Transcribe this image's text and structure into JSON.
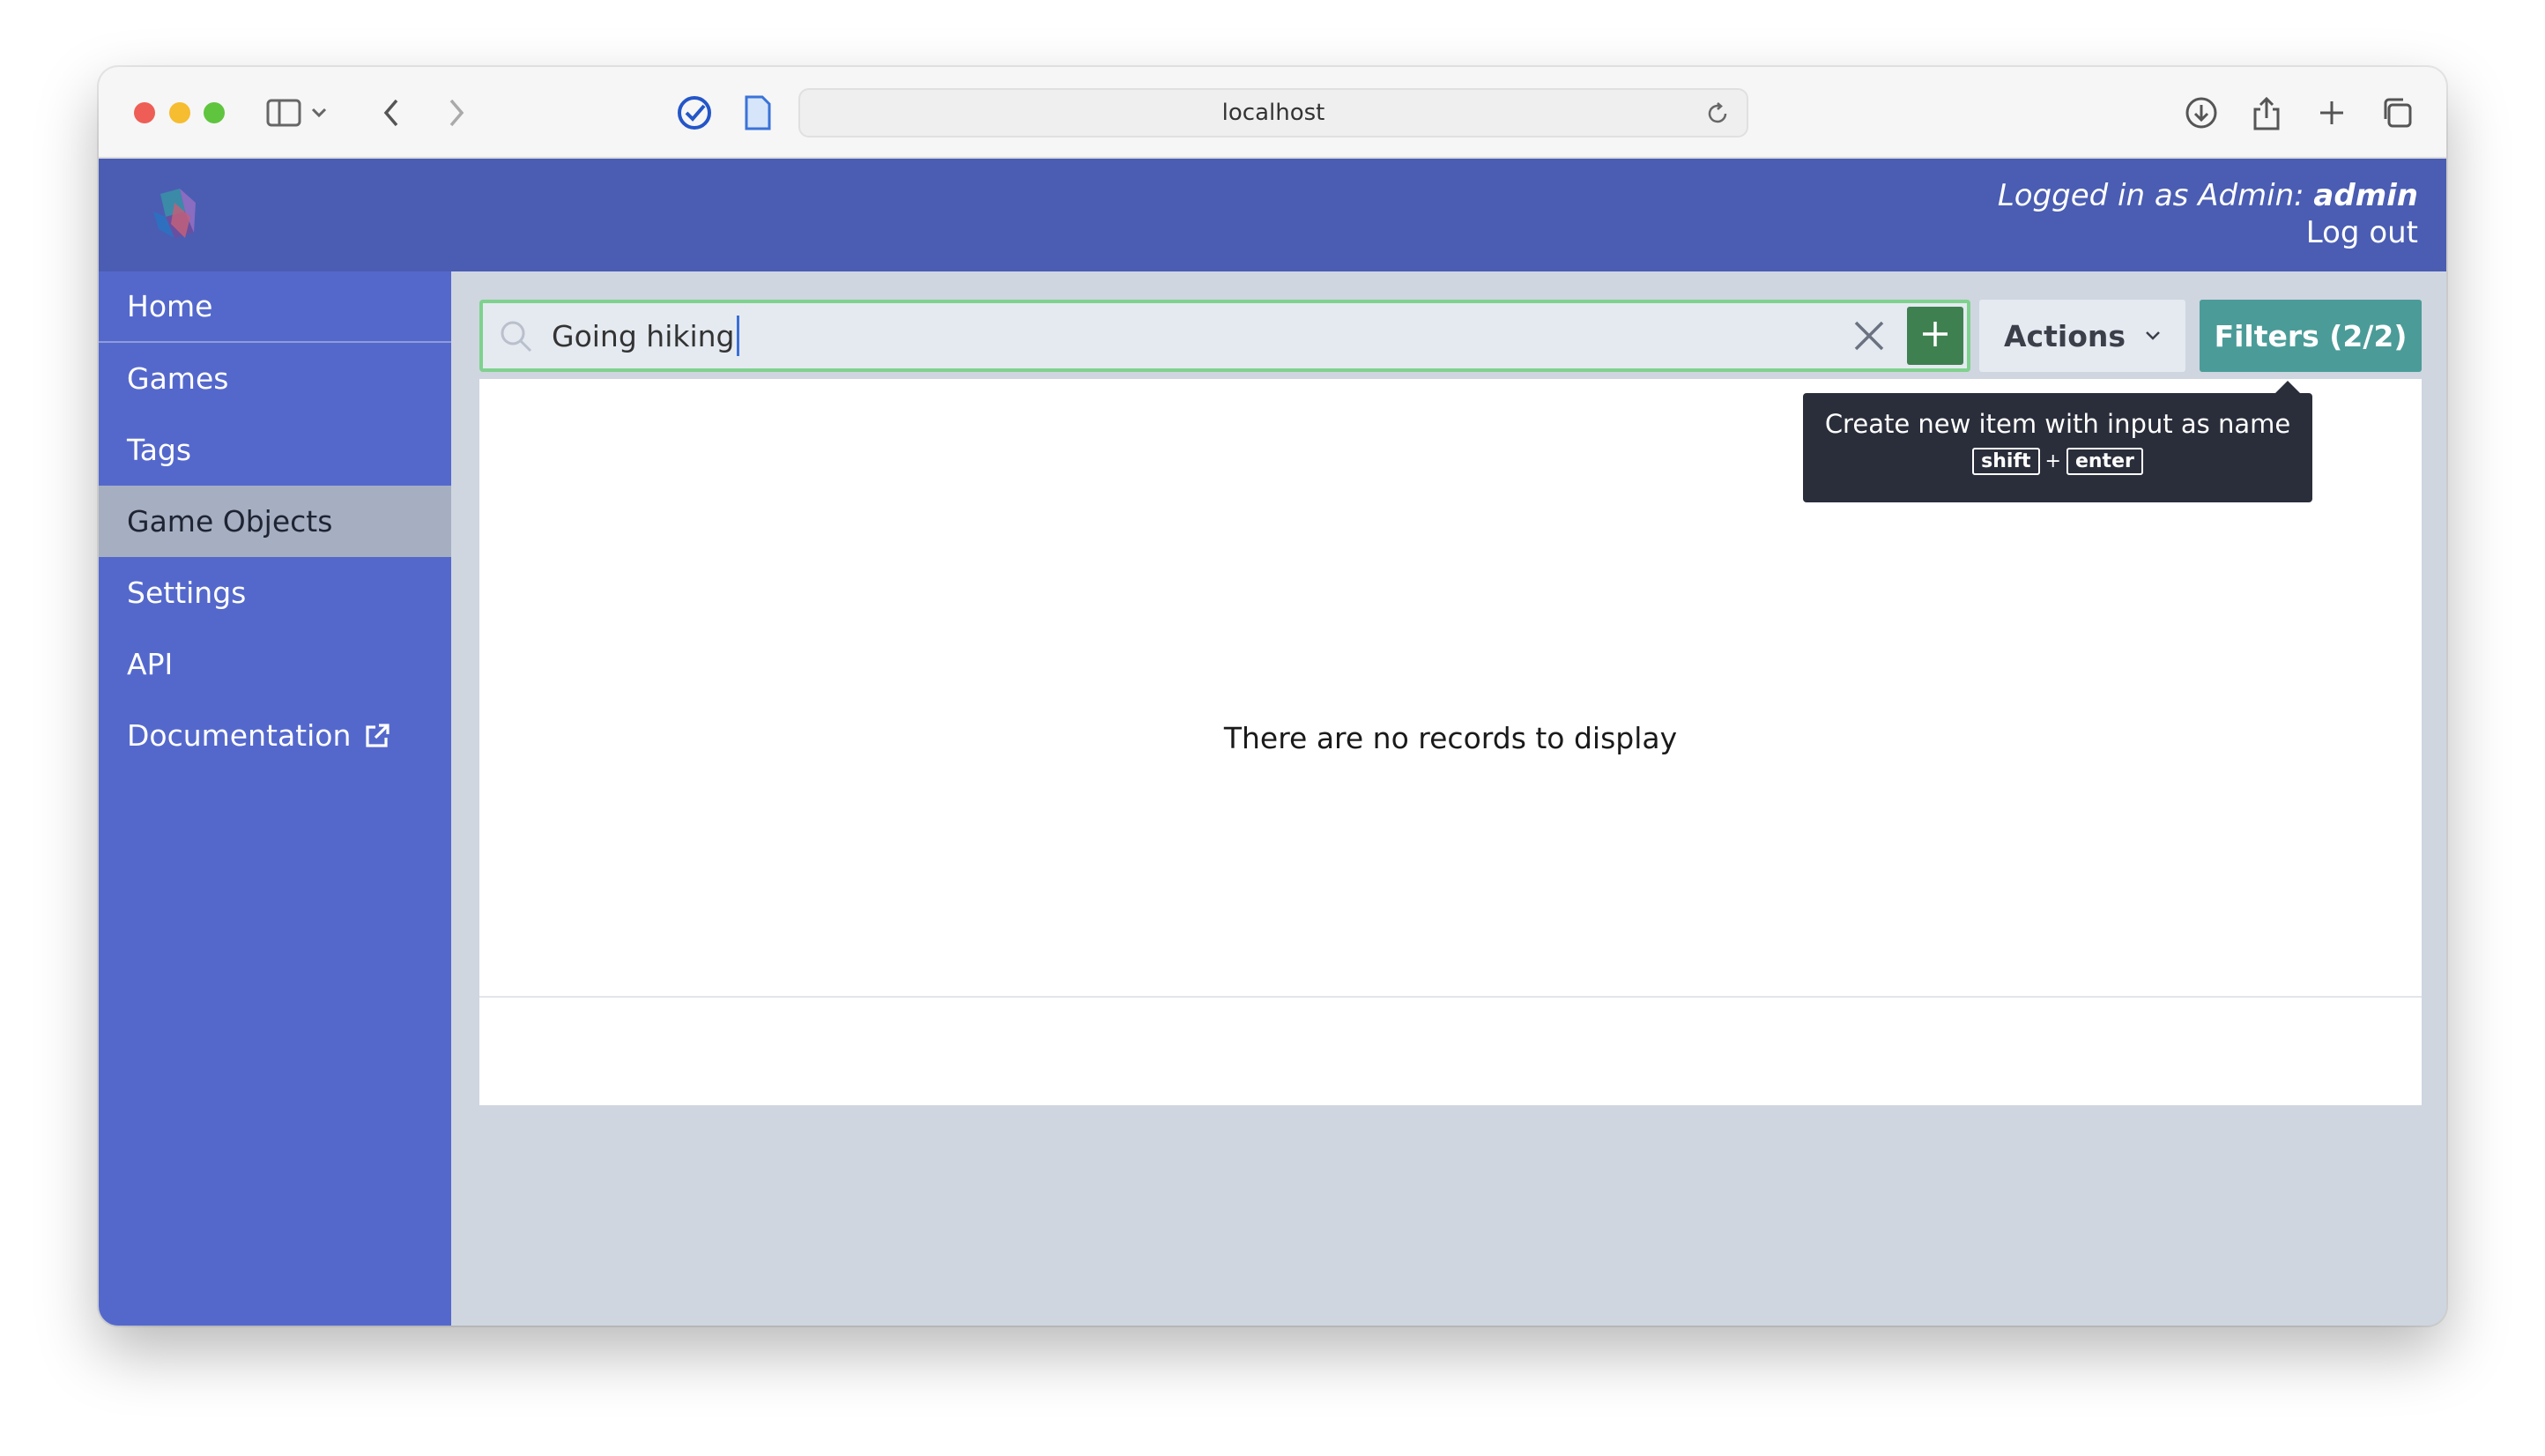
{
  "browser": {
    "url": "localhost"
  },
  "header": {
    "login_prefix": "Logged in as Admin:",
    "username": "admin",
    "logout_label": "Log out"
  },
  "sidebar": {
    "items": [
      {
        "label": "Home"
      },
      {
        "label": "Games"
      },
      {
        "label": "Tags"
      },
      {
        "label": "Game Objects"
      },
      {
        "label": "Settings"
      },
      {
        "label": "API"
      },
      {
        "label": "Documentation"
      }
    ],
    "active_index": 3
  },
  "search": {
    "value": "Going hiking"
  },
  "toolbar": {
    "actions_label": "Actions",
    "filters_label": "Filters (2/2)"
  },
  "tooltip": {
    "text": "Create new item with input as name",
    "key1": "shift",
    "plus": "+",
    "key2": "enter"
  },
  "table": {
    "empty_message": "There are no records to display"
  },
  "colors": {
    "header": "#4a5db3",
    "sidebar": "#5468cc",
    "sidebar_active": "#a5afc1",
    "add_button": "#3f8050",
    "filters_button": "#4b9c98",
    "search_border": "#7fd18e"
  }
}
